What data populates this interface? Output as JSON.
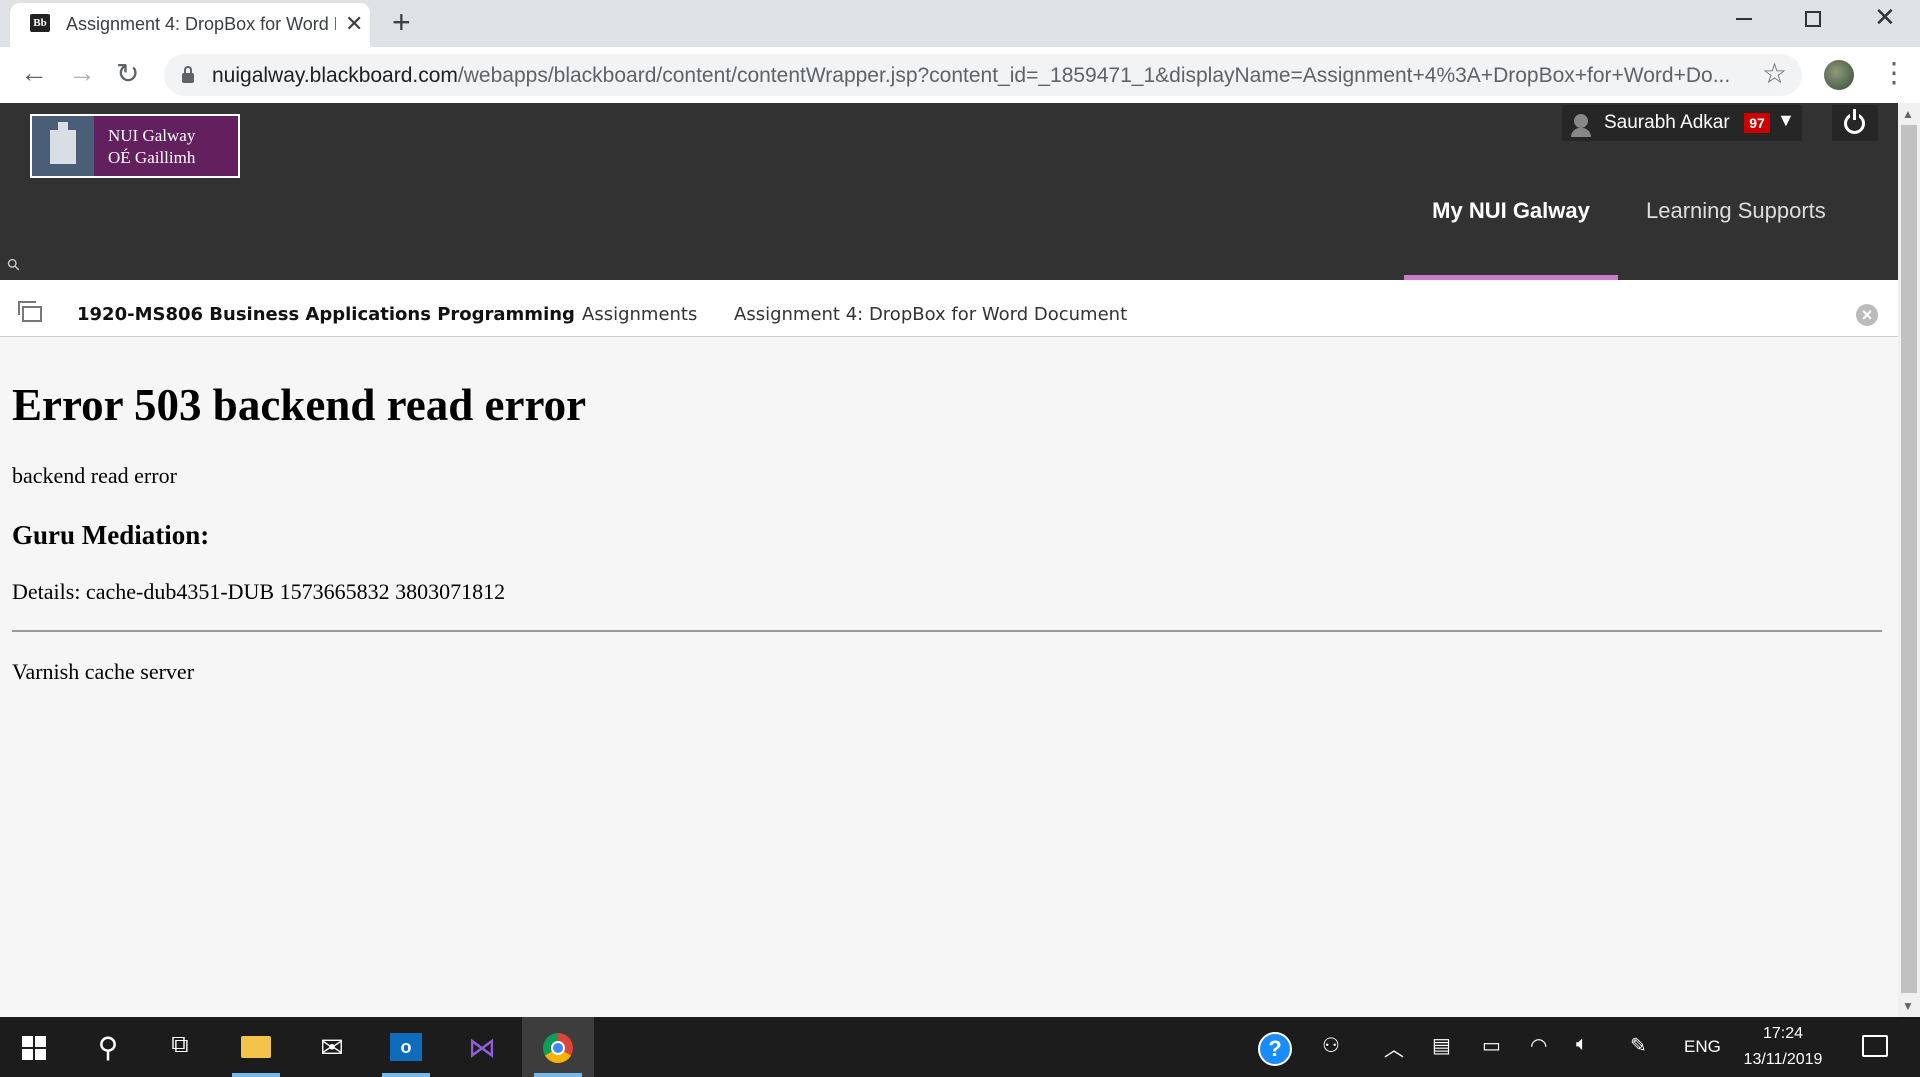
{
  "browser": {
    "tab_title": "Assignment 4: DropBox for Word Document",
    "favicon_text": "Bb",
    "url_host": "nuigalway.blackboard.com",
    "url_path": "/webapps/blackboard/content/contentWrapper.jsp?content_id=_1859471_1&displayName=Assignment+4%3A+DropBox+for+Word+Do..."
  },
  "header": {
    "logo_line1": "NUI Galway",
    "logo_line2": "OÉ Gaillimh",
    "user_name": "Saurabh Adkar",
    "notification_count": "97",
    "tabs": [
      "My NUI Galway",
      "Learning Supports"
    ],
    "active_tab_color": "#c77dcb"
  },
  "breadcrumb": {
    "course": "1920-MS806 Business Applications Programming",
    "section": "Assignments",
    "current": "Assignment 4: DropBox for Word Document"
  },
  "error": {
    "title": "Error 503 backend read error",
    "message": "backend read error",
    "guru_heading": "Guru Mediation:",
    "details": "Details: cache-dub4351-DUB 1573665832 3803071812",
    "footer": "Varnish cache server"
  },
  "taskbar": {
    "language": "ENG",
    "time": "17:24",
    "date": "13/11/2019",
    "icons": [
      "windows-start-icon",
      "search-icon",
      "task-view-icon",
      "file-explorer-icon",
      "mail-icon",
      "outlook-icon",
      "visual-studio-icon",
      "chrome-icon"
    ]
  },
  "colors": {
    "header_bg": "#323232",
    "logo_bg": "#63205f",
    "badge_bg": "#cc0000"
  }
}
